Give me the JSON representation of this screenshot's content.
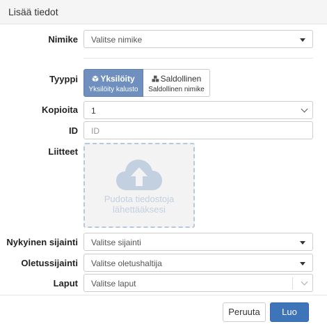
{
  "header": {
    "title": "Lisää tiedot"
  },
  "form": {
    "nimike": {
      "label": "Nimike",
      "value": "Valitse nimike"
    },
    "tyyppi": {
      "label": "Tyyppi",
      "options": [
        {
          "title": "Yksilöity",
          "subtitle": "Yksilöity kalusto",
          "icon": "cube-icon",
          "active": true
        },
        {
          "title": "Saldollinen",
          "subtitle": "Saldollinen nimike",
          "icon": "cubes-icon",
          "active": false
        }
      ]
    },
    "kopioita": {
      "label": "Kopioita",
      "value": "1"
    },
    "id": {
      "label": "ID",
      "placeholder": "ID"
    },
    "liitteet": {
      "label": "Liitteet",
      "dropzone_text": "Pudota tiedostoja lähettääksesi",
      "icon": "cloud-upload-icon"
    },
    "nykyinen_sijainti": {
      "label": "Nykyinen sijainti",
      "value": "Valitse sijainti"
    },
    "oletussijainti": {
      "label": "Oletussijainti",
      "value": "Valitse oletushaltija"
    },
    "laput": {
      "label": "Laput",
      "value": "Valitse laput"
    }
  },
  "footer": {
    "cancel_label": "Peruuta",
    "create_label": "Luo"
  },
  "colors": {
    "accent": "#3e74b8",
    "toggle_active": "#6f8fbf",
    "dropzone_icon": "#c2d0e0"
  }
}
